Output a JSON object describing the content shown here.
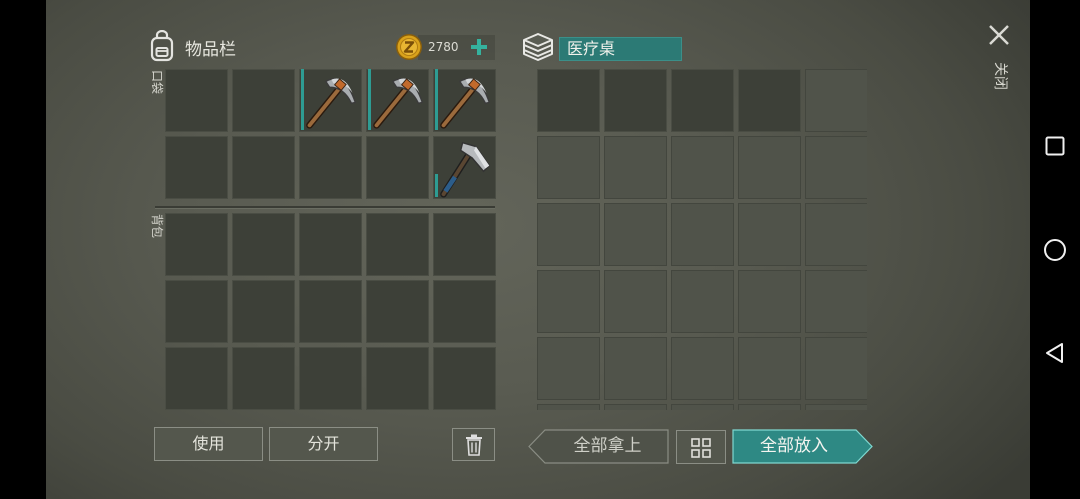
{
  "left_panel": {
    "title": "物品栏",
    "title_icon": "backpack-icon",
    "currency": {
      "icon": "coin-icon",
      "amount": "2780",
      "add_icon": "plus-icon"
    },
    "pocket_label": "口袋",
    "backpack_label": "背包",
    "pocket_slots": [
      {
        "item": null
      },
      {
        "item": null
      },
      {
        "item": "pickaxe-icon",
        "durability": 1.0
      },
      {
        "item": "pickaxe-icon",
        "durability": 1.0
      },
      {
        "item": "pickaxe-icon",
        "durability": 1.0
      },
      {
        "item": null
      },
      {
        "item": null
      },
      {
        "item": null
      },
      {
        "item": null
      },
      {
        "item": "hatchet-icon",
        "durability": 0.37
      }
    ],
    "backpack_slots": [
      {
        "item": null
      },
      {
        "item": null
      },
      {
        "item": null
      },
      {
        "item": null
      },
      {
        "item": null
      },
      {
        "item": null
      },
      {
        "item": null
      },
      {
        "item": null
      },
      {
        "item": null
      },
      {
        "item": null
      },
      {
        "item": null
      },
      {
        "item": null
      },
      {
        "item": null
      },
      {
        "item": null
      },
      {
        "item": null
      }
    ],
    "use_button": "使用",
    "split_button": "分开",
    "delete_icon": "trash-icon"
  },
  "right_panel": {
    "title": "医疗桌",
    "title_icon": "layers-icon",
    "close_icon": "close-icon",
    "close_label": "关闭",
    "slots": [
      {
        "available": true
      },
      {
        "available": true
      },
      {
        "available": true
      },
      {
        "available": true
      },
      {
        "available": false
      },
      {
        "available": false
      },
      {
        "available": false
      },
      {
        "available": false
      },
      {
        "available": false
      },
      {
        "available": false
      },
      {
        "available": false
      },
      {
        "available": false
      },
      {
        "available": false
      },
      {
        "available": false
      },
      {
        "available": false
      },
      {
        "available": false
      },
      {
        "available": false
      },
      {
        "available": false
      },
      {
        "available": false
      },
      {
        "available": false
      },
      {
        "available": false
      },
      {
        "available": false
      },
      {
        "available": false
      },
      {
        "available": false
      },
      {
        "available": false
      },
      {
        "available": false
      },
      {
        "available": false
      },
      {
        "available": false
      },
      {
        "available": false
      },
      {
        "available": false
      }
    ],
    "take_all_button": "全部拿上",
    "sort_icon": "grid-icon",
    "put_all_button": "全部放入"
  },
  "nav_bar": {
    "recents_icon": "square-icon",
    "home_icon": "circle-icon",
    "back_icon": "back-triangle-icon"
  },
  "colors": {
    "accent": "#2c7a75",
    "durability": "#2e9c93",
    "coin": "#d9a21b",
    "plus": "#35b29e",
    "text": "#e2e2da"
  }
}
